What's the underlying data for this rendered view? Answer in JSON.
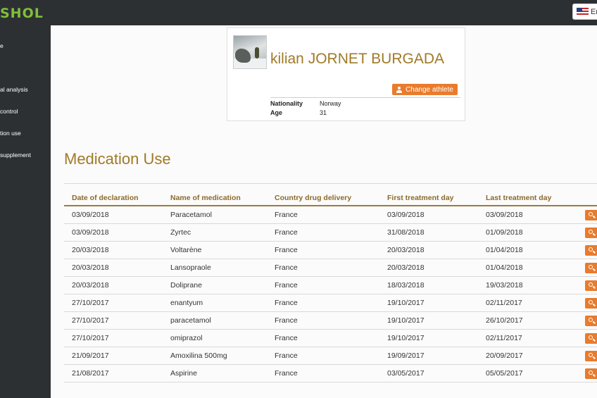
{
  "header": {
    "logo_text": "SHOL",
    "language_label": "En"
  },
  "sidebar": {
    "items": [
      {
        "label": "e"
      },
      {
        "label": "al analysis"
      },
      {
        "label": "control"
      },
      {
        "label": "tion use"
      },
      {
        "label": "supplement"
      }
    ]
  },
  "athlete": {
    "name": "kilian JORNET BURGADA",
    "change_label": "Change athlete",
    "nationality_label": "Nationality",
    "nationality": "Norway",
    "age_label": "Age",
    "age": "31"
  },
  "page": {
    "title": "Medication Use"
  },
  "table": {
    "columns": [
      "Date of declaration",
      "Name of medication",
      "Country drug delivery",
      "First treatment day",
      "Last treatment day"
    ],
    "rows": [
      [
        "03/09/2018",
        "Paracetamol",
        "France",
        "03/09/2018",
        "03/09/2018"
      ],
      [
        "03/09/2018",
        "Zyrtec",
        "France",
        "31/08/2018",
        "01/09/2018"
      ],
      [
        "20/03/2018",
        "Voltarène",
        "France",
        "20/03/2018",
        "01/04/2018"
      ],
      [
        "20/03/2018",
        "Lansopraole",
        "France",
        "20/03/2018",
        "01/04/2018"
      ],
      [
        "20/03/2018",
        "Doliprane",
        "France",
        "18/03/2018",
        "19/03/2018"
      ],
      [
        "27/10/2017",
        "enantyum",
        "France",
        "19/10/2017",
        "02/11/2017"
      ],
      [
        "27/10/2017",
        "paracetamol",
        "France",
        "19/10/2017",
        "26/10/2017"
      ],
      [
        "27/10/2017",
        "omiprazol",
        "France",
        "19/10/2017",
        "02/11/2017"
      ],
      [
        "21/09/2017",
        "Amoxilina 500mg",
        "France",
        "19/09/2017",
        "20/09/2017"
      ],
      [
        "21/08/2017",
        "Aspirine",
        "France",
        "03/05/2017",
        "05/05/2017"
      ]
    ]
  },
  "colors": {
    "accent_gold": "#a07a26",
    "button_orange": "#e97b2c",
    "sidebar_dark": "#2d3033",
    "logo_green": "#7fbf3a"
  },
  "icons": {
    "change_athlete": "user-icon",
    "view_row": "search-icon",
    "language": "us-flag-icon"
  }
}
